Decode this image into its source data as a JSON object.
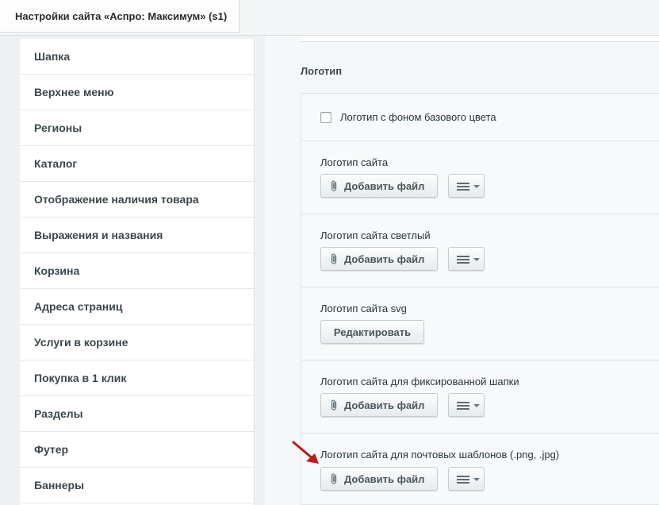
{
  "tab": {
    "title": "Настройки сайта «Аспро: Максимум» (s1)"
  },
  "sidebar": {
    "items": [
      {
        "label": "Шапка"
      },
      {
        "label": "Верхнее меню"
      },
      {
        "label": "Регионы"
      },
      {
        "label": "Каталог"
      },
      {
        "label": "Отображение наличия товара"
      },
      {
        "label": "Выражения и названия"
      },
      {
        "label": "Корзина"
      },
      {
        "label": "Адреса страниц"
      },
      {
        "label": "Услуги в корзине"
      },
      {
        "label": "Покупка в 1 клик"
      },
      {
        "label": "Разделы"
      },
      {
        "label": "Футер"
      },
      {
        "label": "Баннеры"
      }
    ]
  },
  "main": {
    "section_title": "Логотип",
    "checkbox_label": "Логотип с фоном базового цвета",
    "checkbox_checked": false,
    "fields": [
      {
        "label": "Логотип сайта",
        "add_label": "Добавить файл"
      },
      {
        "label": "Логотип сайта светлый",
        "add_label": "Добавить файл"
      },
      {
        "label": "Логотип сайта svg",
        "edit_label": "Редактировать"
      },
      {
        "label": "Логотип сайта для фиксированной шапки",
        "add_label": "Добавить файл"
      },
      {
        "label": "Логотип сайта для почтовых шаблонов (.png, .jpg)",
        "add_label": "Добавить файл"
      }
    ]
  },
  "colors": {
    "background": "#eef1f2",
    "annotation_arrow": "#c0181f"
  },
  "icons": {
    "attach": "paperclip-icon",
    "menu": "hamburger-menu-icon",
    "dropdown": "caret-down-icon"
  }
}
